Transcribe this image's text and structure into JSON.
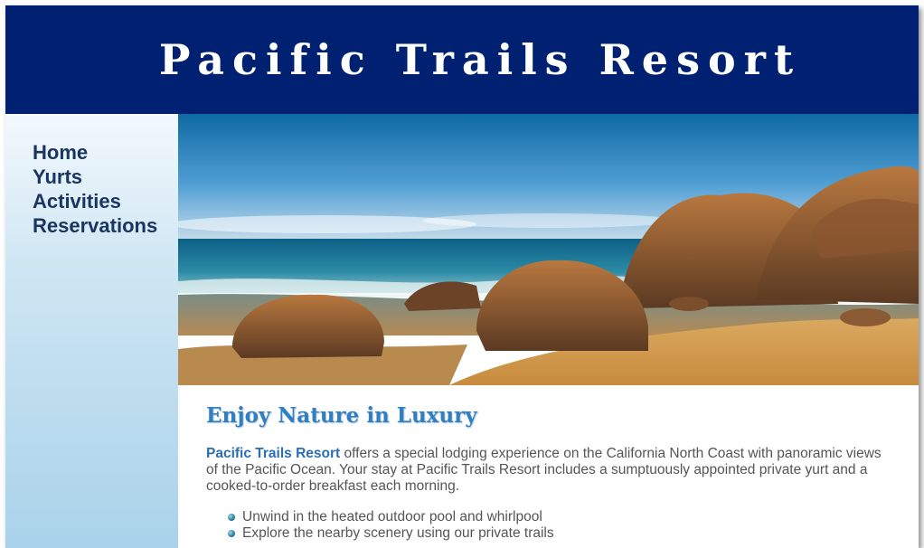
{
  "header": {
    "title": "Pacific Trails Resort"
  },
  "nav": {
    "items": [
      {
        "label": "Home"
      },
      {
        "label": "Yurts"
      },
      {
        "label": "Activities"
      },
      {
        "label": "Reservations"
      }
    ]
  },
  "main": {
    "heading": "Enjoy Nature in Luxury",
    "intro_name": "Pacific Trails Resort",
    "intro_rest": " offers a special lodging experience on the California North Coast with panoramic views of the Pacific Ocean. Your stay at Pacific Trails Resort includes a sumptuously appointed private yurt and a cooked-to-order breakfast each morning.",
    "features": [
      {
        "text": "Unwind in the heated outdoor pool and whirlpool"
      },
      {
        "text": "Explore the nearby scenery using our private trails"
      }
    ]
  },
  "colors": {
    "header_bg": "#002171",
    "heading": "#2f7fc5",
    "nav_text": "#1a3560",
    "body_text": "#555555"
  },
  "icons": {
    "feature_bullet": "bullet-dot-icon"
  }
}
